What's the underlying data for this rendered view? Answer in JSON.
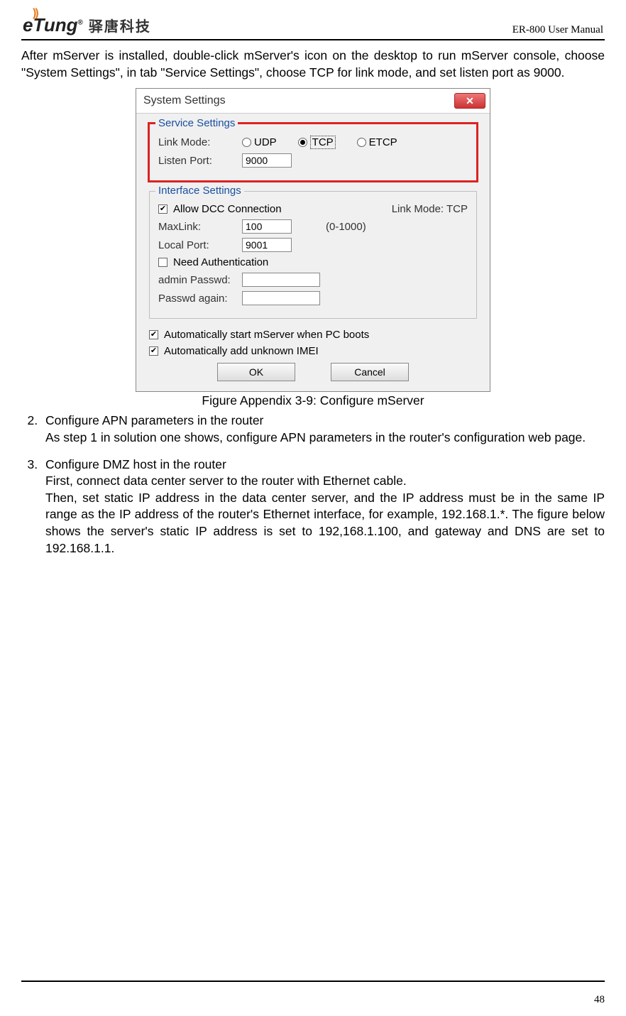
{
  "header": {
    "logo_text": "eTung",
    "logo_reg": "®",
    "cn_text": "驿唐科技",
    "manual": "ER-800 User Manual"
  },
  "intro_text": "After mServer is installed, double-click mServer's icon on the desktop to run mServer console, choose \"System Settings\", in tab \"Service Settings\", choose TCP for link mode, and set listen port as 9000.",
  "dialog": {
    "title": "System Settings",
    "service_legend": "Service Settings",
    "link_mode_label": "Link Mode:",
    "radio_udp": "UDP",
    "radio_tcp": "TCP",
    "radio_etcp": "ETCP",
    "listen_port_label": "Listen Port:",
    "listen_port_value": "9000",
    "interface_legend": "Interface Settings",
    "allow_dcc_label": "Allow DCC Connection",
    "link_mode_tcp_label": "Link Mode: TCP",
    "maxlink_label": "MaxLink:",
    "maxlink_value": "100",
    "maxlink_hint": "(0-1000)",
    "local_port_label": "Local Port:",
    "local_port_value": "9001",
    "need_auth_label": "Need Authentication",
    "admin_pw_label": "admin Passwd:",
    "pw_again_label": "Passwd again:",
    "autostart_label": "Automatically start mServer when PC boots",
    "autoadd_label": "Automatically add unknown IMEI",
    "ok_label": "OK",
    "cancel_label": "Cancel"
  },
  "figure_caption": "Figure Appendix 3-9: Configure mServer",
  "steps": {
    "s2_title": "Configure APN parameters in the router",
    "s2_body": "As step 1 in solution one shows, configure APN parameters in the router's configuration web page.",
    "s3_title": "Configure DMZ host in the router",
    "s3_body1": "First, connect data center server to the router with Ethernet cable.",
    "s3_body2": "Then, set static IP address in the data center server, and the IP address must be in the same IP range as the IP address of the router's Ethernet interface, for example, 192.168.1.*. The figure below shows the server's static IP address is set to 192,168.1.100, and gateway and DNS are set to 192.168.1.1."
  },
  "page_number": "48"
}
